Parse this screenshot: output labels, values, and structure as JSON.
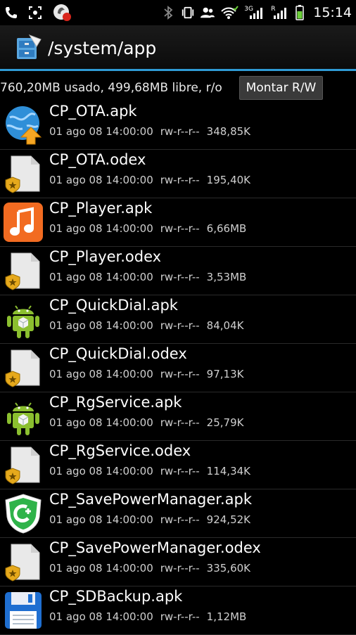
{
  "status_bar": {
    "time": "15:14",
    "left_icons": [
      "phone-call-icon",
      "screenshot-icon",
      "notification-badge-icon"
    ],
    "right_icons": [
      "bluetooth-icon",
      "vibrate-icon",
      "contacts-icon",
      "wifi-icon",
      "signal-3g-icon",
      "signal-icon",
      "battery-icon"
    ],
    "network_labels": {
      "three_g": "3G",
      "r": "R"
    }
  },
  "title_bar": {
    "path": "/system/app",
    "icon": "file-cabinet-icon"
  },
  "info": {
    "usage": "760,20MB usado, 499,68MB libre, r/o",
    "mount_label": "Montar R/W"
  },
  "files": [
    {
      "name": "CP_OTA.apk",
      "date": "01 ago 08 14:00:00",
      "perms": "rw-r--r--",
      "size": "348,85K",
      "icon": "globe-upload-icon"
    },
    {
      "name": "CP_OTA.odex",
      "date": "01 ago 08 14:00:00",
      "perms": "rw-r--r--",
      "size": "195,40K",
      "icon": "odex-file-icon"
    },
    {
      "name": "CP_Player.apk",
      "date": "01 ago 08 14:00:00",
      "perms": "rw-r--r--",
      "size": "6,66MB",
      "icon": "music-note-icon"
    },
    {
      "name": "CP_Player.odex",
      "date": "01 ago 08 14:00:00",
      "perms": "rw-r--r--",
      "size": "3,53MB",
      "icon": "odex-file-icon"
    },
    {
      "name": "CP_QuickDial.apk",
      "date": "01 ago 08 14:00:00",
      "perms": "rw-r--r--",
      "size": "84,04K",
      "icon": "android-icon"
    },
    {
      "name": "CP_QuickDial.odex",
      "date": "01 ago 08 14:00:00",
      "perms": "rw-r--r--",
      "size": "97,13K",
      "icon": "odex-file-icon"
    },
    {
      "name": "CP_RgService.apk",
      "date": "01 ago 08 14:00:00",
      "perms": "rw-r--r--",
      "size": "25,79K",
      "icon": "android-icon"
    },
    {
      "name": "CP_RgService.odex",
      "date": "01 ago 08 14:00:00",
      "perms": "rw-r--r--",
      "size": "114,34K",
      "icon": "odex-file-icon"
    },
    {
      "name": "CP_SavePowerManager.apk",
      "date": "01 ago 08 14:00:00",
      "perms": "rw-r--r--",
      "size": "924,52K",
      "icon": "shield-plus-icon"
    },
    {
      "name": "CP_SavePowerManager.odex",
      "date": "01 ago 08 14:00:00",
      "perms": "rw-r--r--",
      "size": "335,60K",
      "icon": "odex-file-icon"
    },
    {
      "name": "CP_SDBackup.apk",
      "date": "01 ago 08 14:00:00",
      "perms": "rw-r--r--",
      "size": "1,12MB",
      "icon": "floppy-disk-icon"
    }
  ],
  "colors": {
    "accent": "#2f9bd6",
    "background": "#000000",
    "android_green": "#8bbf2f",
    "music_orange": "#f26b21"
  }
}
